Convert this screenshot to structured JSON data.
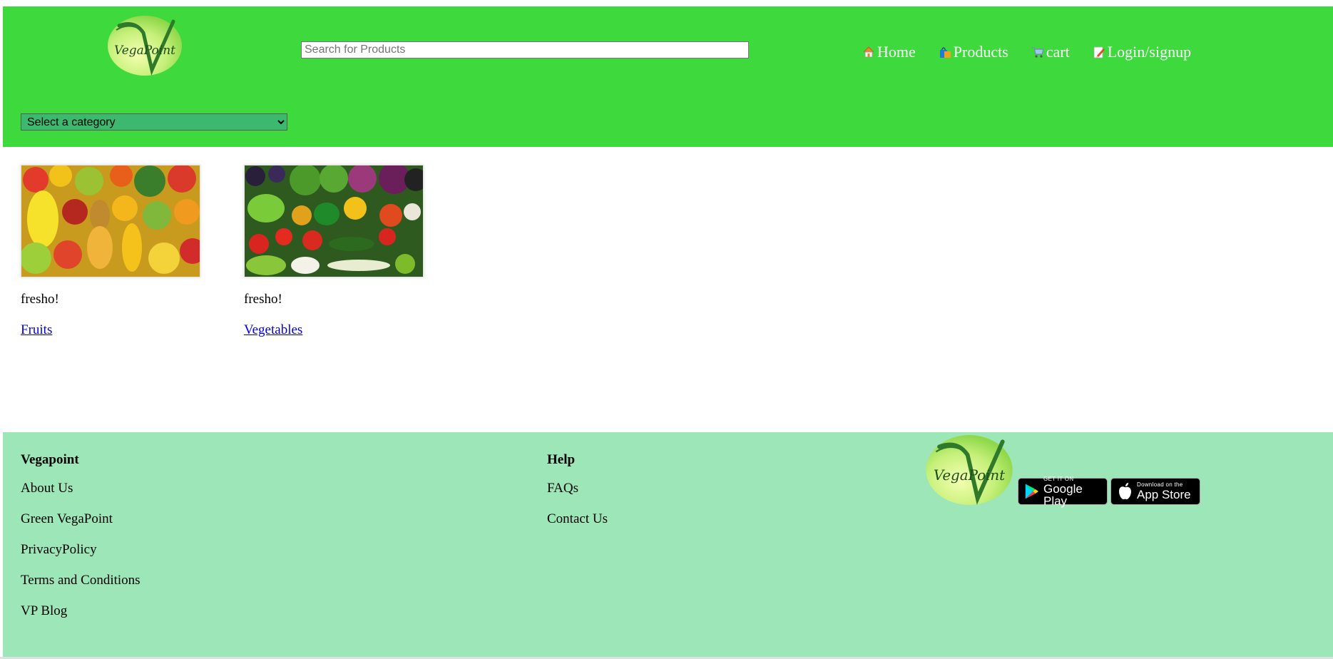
{
  "header": {
    "logo_text": "VegaPoint",
    "search_placeholder": "Search for Products",
    "category_select": {
      "selected": "Select a category"
    },
    "nav": [
      {
        "label": "Home",
        "icon": "home-icon"
      },
      {
        "label": "Products",
        "icon": "shopping-bag-icon"
      },
      {
        "label": "cart",
        "icon": "cart-icon"
      },
      {
        "label": "Login/signup",
        "icon": "signup-icon"
      }
    ]
  },
  "products": [
    {
      "tagline": "fresho!",
      "link": "Fruits",
      "image": "fruits-image"
    },
    {
      "tagline": "fresho!",
      "link": "Vegetables",
      "image": "vegetables-image"
    }
  ],
  "footer": {
    "col1": {
      "heading": "Vegapoint",
      "links": [
        "About Us",
        "Green VegaPoint",
        "PrivacyPolicy",
        "Terms and Conditions",
        "VP Blog"
      ]
    },
    "col2": {
      "heading": "Help",
      "links": [
        "FAQs",
        "Contact Us"
      ]
    },
    "logo_text": "VegaPoint",
    "badges": {
      "google": {
        "small": "GET IT ON",
        "big": "Google Play"
      },
      "apple": {
        "small": "Download on the",
        "big": "App Store"
      }
    }
  },
  "colors": {
    "header_bg": "#3dd93d",
    "footer_bg": "#9ce6b8",
    "select_bg": "#3cb96e",
    "link": "#0000ee"
  }
}
